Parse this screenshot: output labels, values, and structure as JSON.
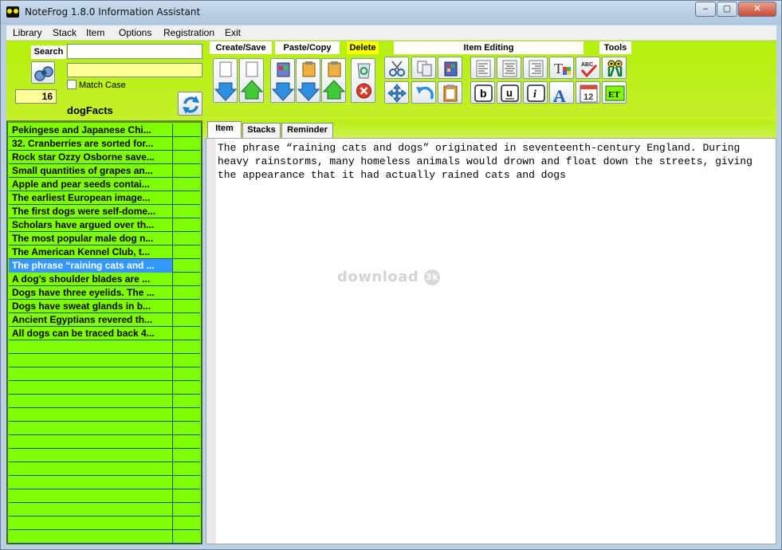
{
  "window": {
    "title": "NoteFrog 1.8.0 Information Assistant",
    "min": "–",
    "max": "▢",
    "close": "✕"
  },
  "menu": [
    "Library",
    "Stack",
    "Item",
    "Options",
    "Registration",
    "Exit"
  ],
  "search": {
    "label": "Search",
    "value": "",
    "match_case": "Match Case",
    "count": "16",
    "stack_name": "dogFacts"
  },
  "toolbar_groups": {
    "create_save": "Create/Save",
    "paste_copy": "Paste/Copy",
    "delete": "Delete",
    "item_editing": "Item Editing",
    "tools": "Tools"
  },
  "icons": {
    "search": "binoculars-icon",
    "refresh": "refresh-icon",
    "new_down": "new-item-down-icon",
    "new_up": "new-item-up-icon",
    "paste_down": "paste-down-icon",
    "paste_down2": "paste-copy-down-icon",
    "paste_up": "paste-up-icon",
    "recycle": "recycle-bin-icon",
    "delete": "delete-icon",
    "cut": "cut-icon",
    "copy": "copy-icon",
    "paste": "paste-icon",
    "move": "move-icon",
    "undo": "undo-icon",
    "clipboard": "clipboard-icon",
    "align_left": "align-left-icon",
    "align_center": "align-center-icon",
    "align_right": "align-right-icon",
    "bold": "bold-icon",
    "underline": "underline-icon",
    "italic": "italic-icon",
    "font_color": "font-color-icon",
    "font": "font-icon",
    "spell": "spell-check-icon",
    "calendar": "calendar-icon",
    "tool_frog": "frog-tool-icon",
    "tool_et": "et-tool-icon"
  },
  "button_text": {
    "bold": "b",
    "underline": "u",
    "italic": "i",
    "et": "ET",
    "spell": "ABC",
    "calendar": "12",
    "font": "A",
    "font_color": "T"
  },
  "list_items": [
    "Pekingese and Japanese Chi...",
    "32. Cranberries are sorted for...",
    "Rock star Ozzy Osborne save...",
    "Small quantities of grapes an...",
    "Apple and pear seeds contai...",
    "The earliest European image...",
    "The first dogs were self-dome...",
    "Scholars have argued over th...",
    "The most popular male dog n...",
    "The American Kennel Club, t...",
    "The phrase “raining cats and ...",
    "A dog’s shoulder blades are ...",
    "Dogs have three eyelids. The ...",
    "Dogs have sweat glands in b...",
    "Ancient Egyptians revered th...",
    "All dogs can be traced back 4..."
  ],
  "selected_index": 10,
  "empty_rows": 15,
  "tabs": [
    "Item",
    "Stacks",
    "Reminder"
  ],
  "active_tab": "Item",
  "note_text": "The phrase “raining cats and dogs” originated in seventeenth-century England. During heavy rainstorms, many homeless animals would drown and float down the streets, giving the appearance that it had actually rained cats and dogs",
  "watermark": {
    "text": "download",
    "badge": "3k"
  },
  "colors": {
    "toolbar_green": "#b4f00c",
    "list_green": "#7efc00",
    "selection_blue": "#3399ff",
    "yellow_field": "#ffff99"
  }
}
